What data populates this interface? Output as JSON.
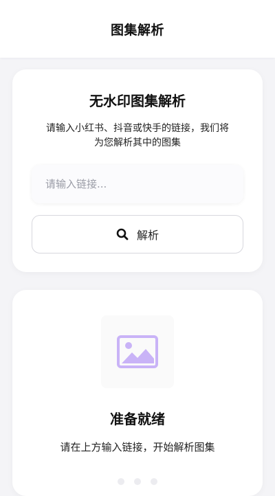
{
  "header": {
    "title": "图集解析"
  },
  "parse_card": {
    "title": "无水印图集解析",
    "description_line1": "请输入小红书、抖音或快手的链接，我们将",
    "description_line2": "为您解析其中的图集",
    "input_placeholder": "请输入链接...",
    "input_value": "",
    "button_label": "解析",
    "button_icon": "search-icon"
  },
  "empty_state": {
    "icon": "image-placeholder-icon",
    "title": "准备就绪",
    "description": "请在上方输入链接，开始解析图集"
  },
  "colors": {
    "accent_icon": "#c9b3f7",
    "background": "#f4f4f7",
    "card": "#ffffff"
  }
}
